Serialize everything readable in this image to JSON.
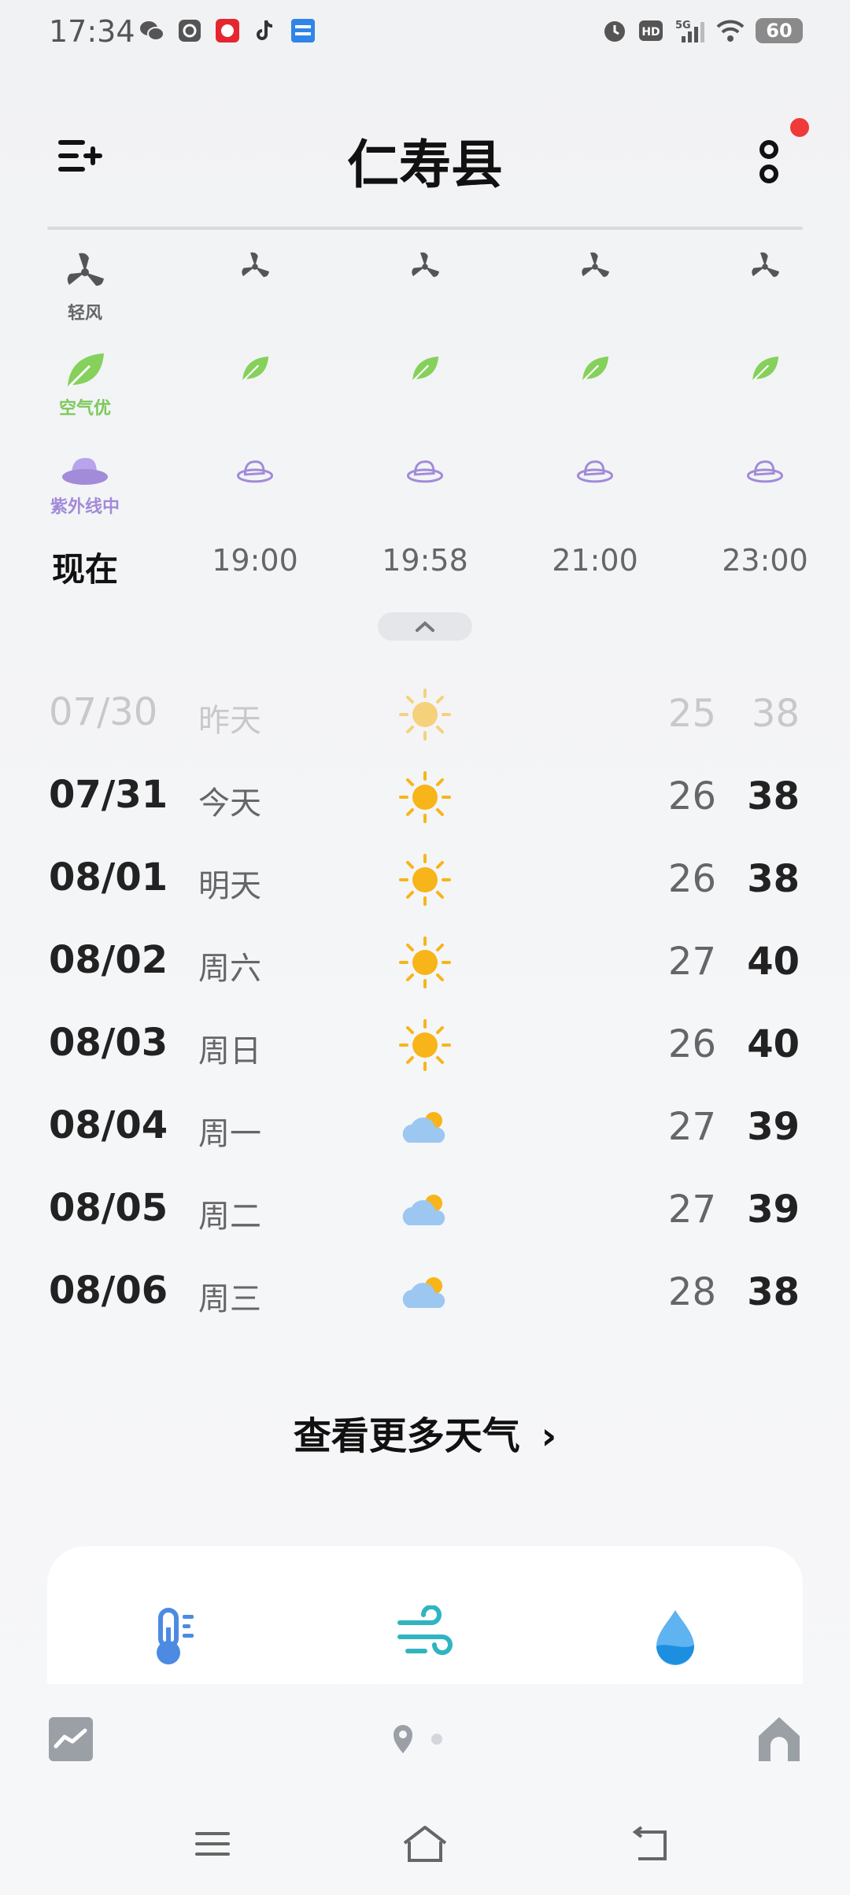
{
  "status_bar": {
    "time": "17:34",
    "app_icons": [
      "wechat-icon",
      "email-icon",
      "gift-app-icon",
      "tiktok-icon",
      "news-app-icon"
    ],
    "right_icons": [
      "alarm-icon",
      "hd-icon",
      "5g-signal-icon",
      "wifi-icon"
    ],
    "battery": "60"
  },
  "header": {
    "city": "仁寿县",
    "has_notification": true
  },
  "hourly": {
    "rows": {
      "wind_label": "轻风",
      "air_label": "空气优",
      "uv_label": "紫外线中"
    },
    "times": [
      "现在",
      "19:00",
      "19:58",
      "21:00",
      "23:00"
    ]
  },
  "daily": [
    {
      "date": "07/30",
      "day": "昨天",
      "icon": "sunny-icon",
      "low": "25",
      "high": "38",
      "past": true
    },
    {
      "date": "07/31",
      "day": "今天",
      "icon": "sunny-icon",
      "low": "26",
      "high": "38",
      "past": false
    },
    {
      "date": "08/01",
      "day": "明天",
      "icon": "sunny-icon",
      "low": "26",
      "high": "38",
      "past": false
    },
    {
      "date": "08/02",
      "day": "周六",
      "icon": "sunny-icon",
      "low": "27",
      "high": "40",
      "past": false
    },
    {
      "date": "08/03",
      "day": "周日",
      "icon": "sunny-icon",
      "low": "26",
      "high": "40",
      "past": false
    },
    {
      "date": "08/04",
      "day": "周一",
      "icon": "partly-cloudy-icon",
      "low": "27",
      "high": "39",
      "past": false
    },
    {
      "date": "08/05",
      "day": "周二",
      "icon": "partly-cloudy-icon",
      "low": "27",
      "high": "39",
      "past": false
    },
    {
      "date": "08/06",
      "day": "周三",
      "icon": "partly-cloudy-icon",
      "low": "28",
      "high": "38",
      "past": false
    }
  ],
  "more_weather": {
    "label": "查看更多天气",
    "arrow": "›"
  },
  "detail_card": {
    "icons": [
      "thermometer-icon",
      "wind-icon",
      "humidity-drop-icon"
    ]
  },
  "colors": {
    "wind": "#555555",
    "air": "#7cc85a",
    "uv": "#a28bd8",
    "sun": "#f7b51a",
    "cloud": "#9cc7f1",
    "notification": "#f03a3a"
  }
}
